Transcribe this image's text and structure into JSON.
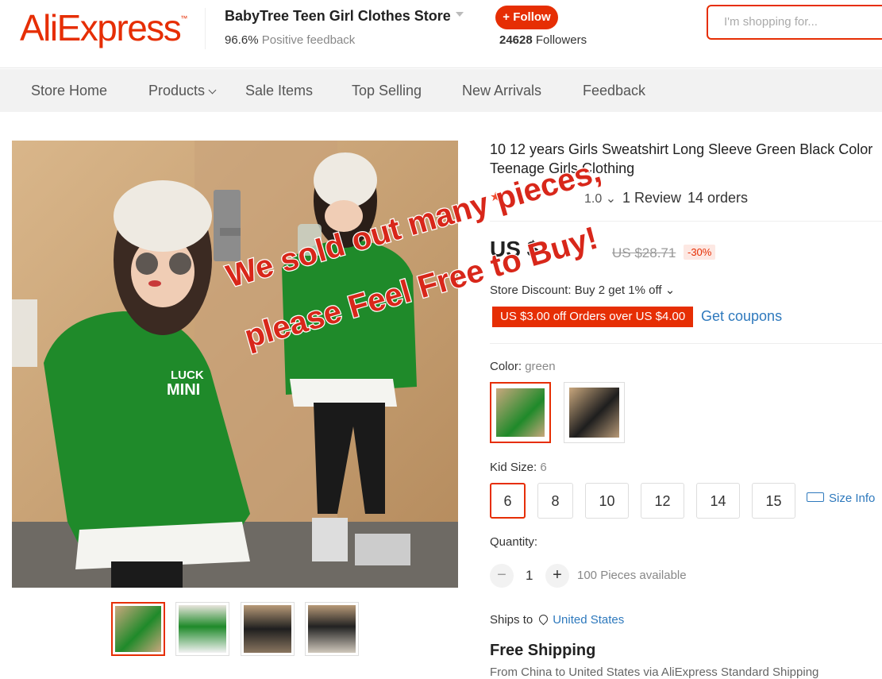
{
  "header": {
    "logo": "AliExpress",
    "store_name": "BabyTree Teen Girl Clothes Store",
    "feedback_pct": "96.6%",
    "feedback_label": "Positive feedback",
    "follow_label": "+ Follow",
    "followers_count": "24628",
    "followers_label": "Followers",
    "search_placeholder": "I'm shopping for..."
  },
  "nav": {
    "items": [
      "Store Home",
      "Products",
      "Sale Items",
      "Top Selling",
      "New Arrivals",
      "Feedback"
    ]
  },
  "product": {
    "title": "10 12 years Girls Sweatshirt Long Sleeve Green Black Color Teenage Girls Clothing",
    "rating": "1.0",
    "reviews": "1 Review",
    "orders": "14 orders",
    "price": "US $",
    "old_price": "US $28.71",
    "discount": "-30%",
    "store_discount": "Store Discount: Buy 2 get 1% off",
    "coupon": "US $3.00 off Orders over US $4.00",
    "get_coupons": "Get coupons",
    "color_label": "Color:",
    "color_value": "green",
    "size_label": "Kid Size:",
    "size_value": "6",
    "sizes": [
      "6",
      "8",
      "10",
      "12",
      "14",
      "15"
    ],
    "size_info": "Size Info",
    "quantity_label": "Quantity:",
    "quantity": "1",
    "available": "100 Pieces available",
    "ships_to_label": "Ships to",
    "ships_to_country": "United States",
    "free_shipping": "Free Shipping",
    "shipping_detail": "From China to United States via AliExpress Standard Shipping"
  },
  "overlay": {
    "line1": "We sold out many pieces,",
    "line2": "please Feel Free to Buy!"
  },
  "image_text": {
    "luck": "LUCK",
    "mini": "MINI"
  },
  "colors": {
    "brand": "#e62e04",
    "link": "#2e79bd",
    "sweater_green": "#1f8a2a"
  }
}
